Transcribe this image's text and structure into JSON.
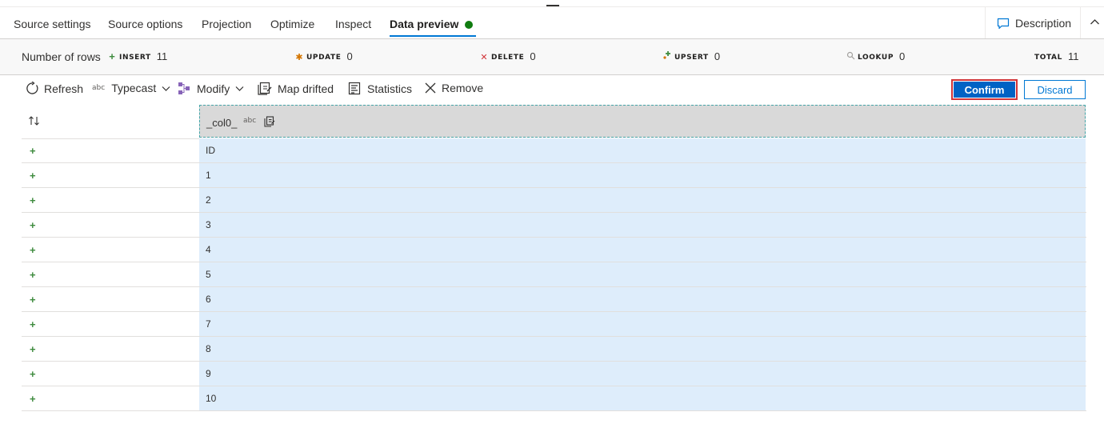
{
  "tabs": [
    {
      "label": "Source settings",
      "active": false
    },
    {
      "label": "Source options",
      "active": false
    },
    {
      "label": "Projection",
      "active": false
    },
    {
      "label": "Optimize",
      "active": false
    },
    {
      "label": "Inspect",
      "active": false
    },
    {
      "label": "Data preview",
      "active": true
    }
  ],
  "status_color": "#107c10",
  "accent_color": "#0078d4",
  "header_actions": {
    "description_label": "Description",
    "description_icon": "chat-bubble-icon",
    "collapse_icon": "chevron-up-icon"
  },
  "stats": {
    "rows_label": "Number of rows",
    "insert": {
      "label": "INSERT",
      "value": "11",
      "icon": "plus-icon",
      "color": "#3e8b3e"
    },
    "update": {
      "label": "UPDATE",
      "value": "0",
      "icon": "asterisk-icon",
      "color": "#d47500"
    },
    "delete": {
      "label": "DELETE",
      "value": "0",
      "icon": "x-icon",
      "color": "#d13438"
    },
    "upsert": {
      "label": "UPSERT",
      "value": "0",
      "icon": "upsert-icon",
      "color": "#3e8b3e"
    },
    "lookup": {
      "label": "LOOKUP",
      "value": "0",
      "icon": "search-icon",
      "color": "#a19f9d"
    },
    "total": {
      "label": "TOTAL",
      "value": "11"
    }
  },
  "toolbar": {
    "refresh": "Refresh",
    "typecast_prefix": "abc",
    "typecast": "Typecast",
    "modify": "Modify",
    "map_drifted": "Map drifted",
    "statistics": "Statistics",
    "remove": "Remove",
    "confirm": "Confirm",
    "discard": "Discard"
  },
  "grid": {
    "column": {
      "name": "_col0_",
      "type": "abc"
    },
    "rows": [
      "ID",
      "1",
      "2",
      "3",
      "4",
      "5",
      "6",
      "7",
      "8",
      "9",
      "10"
    ]
  }
}
